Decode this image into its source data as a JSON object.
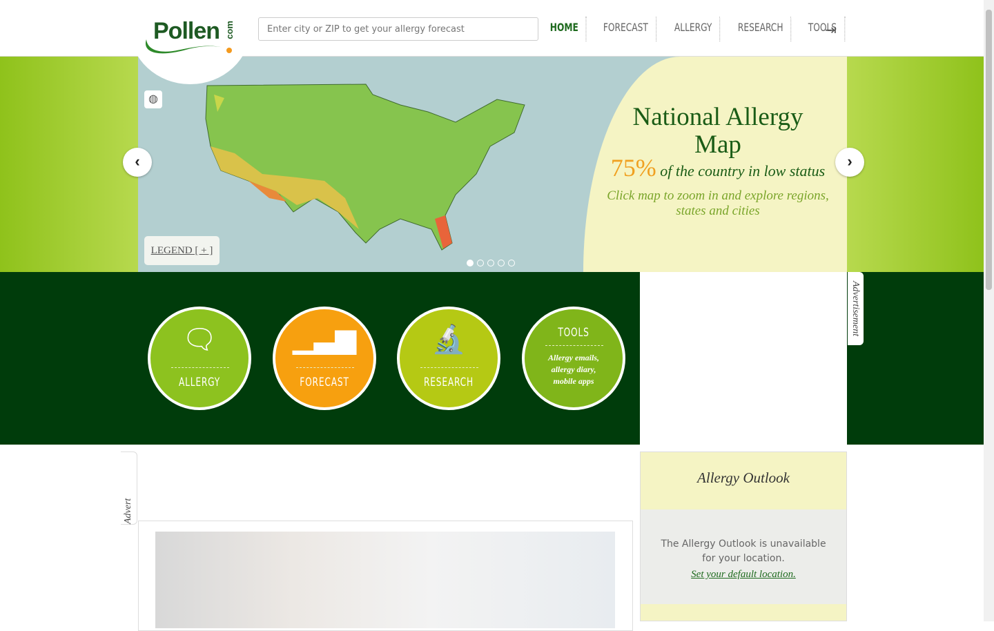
{
  "header": {
    "logo_text": "Pollen",
    "logo_suffix": "com",
    "search_placeholder": "Enter city or ZIP to get your allergy forecast",
    "nav": [
      {
        "label": "HOME",
        "active": true
      },
      {
        "label": "FORECAST"
      },
      {
        "label": "ALLERGY"
      },
      {
        "label": "RESEARCH"
      },
      {
        "label": "TOOLS"
      }
    ],
    "login_icon": "sign-in-icon"
  },
  "hero": {
    "title": "National Allergy Map",
    "percent": "75%",
    "stat_text": "of the country in low status",
    "subtitle": "Click map to zoom in and explore regions, states and cities",
    "legend_label": "LEGEND [ + ]",
    "slides": 5,
    "active_slide": 1,
    "prev": "‹",
    "next": "›"
  },
  "circles": [
    {
      "label": "ALLERGY",
      "color": "#8dc21f",
      "icon": "chat-bubble-icon"
    },
    {
      "label": "FORECAST",
      "color": "#f7a00f",
      "icon": "bar-chart-icon"
    },
    {
      "label": "RESEARCH",
      "color": "#b5c914",
      "icon": "microscope-icon"
    },
    {
      "label": "TOOLS",
      "sub": "Allergy emails, allergy diary, mobile apps",
      "color": "#80b51a"
    }
  ],
  "ads": {
    "right_tab": "Advertisement",
    "left_tab": "Advert"
  },
  "outlook": {
    "title": "Allergy Outlook",
    "message": "The Allergy Outlook is unavailable for your location.",
    "link": "Set your default location."
  }
}
